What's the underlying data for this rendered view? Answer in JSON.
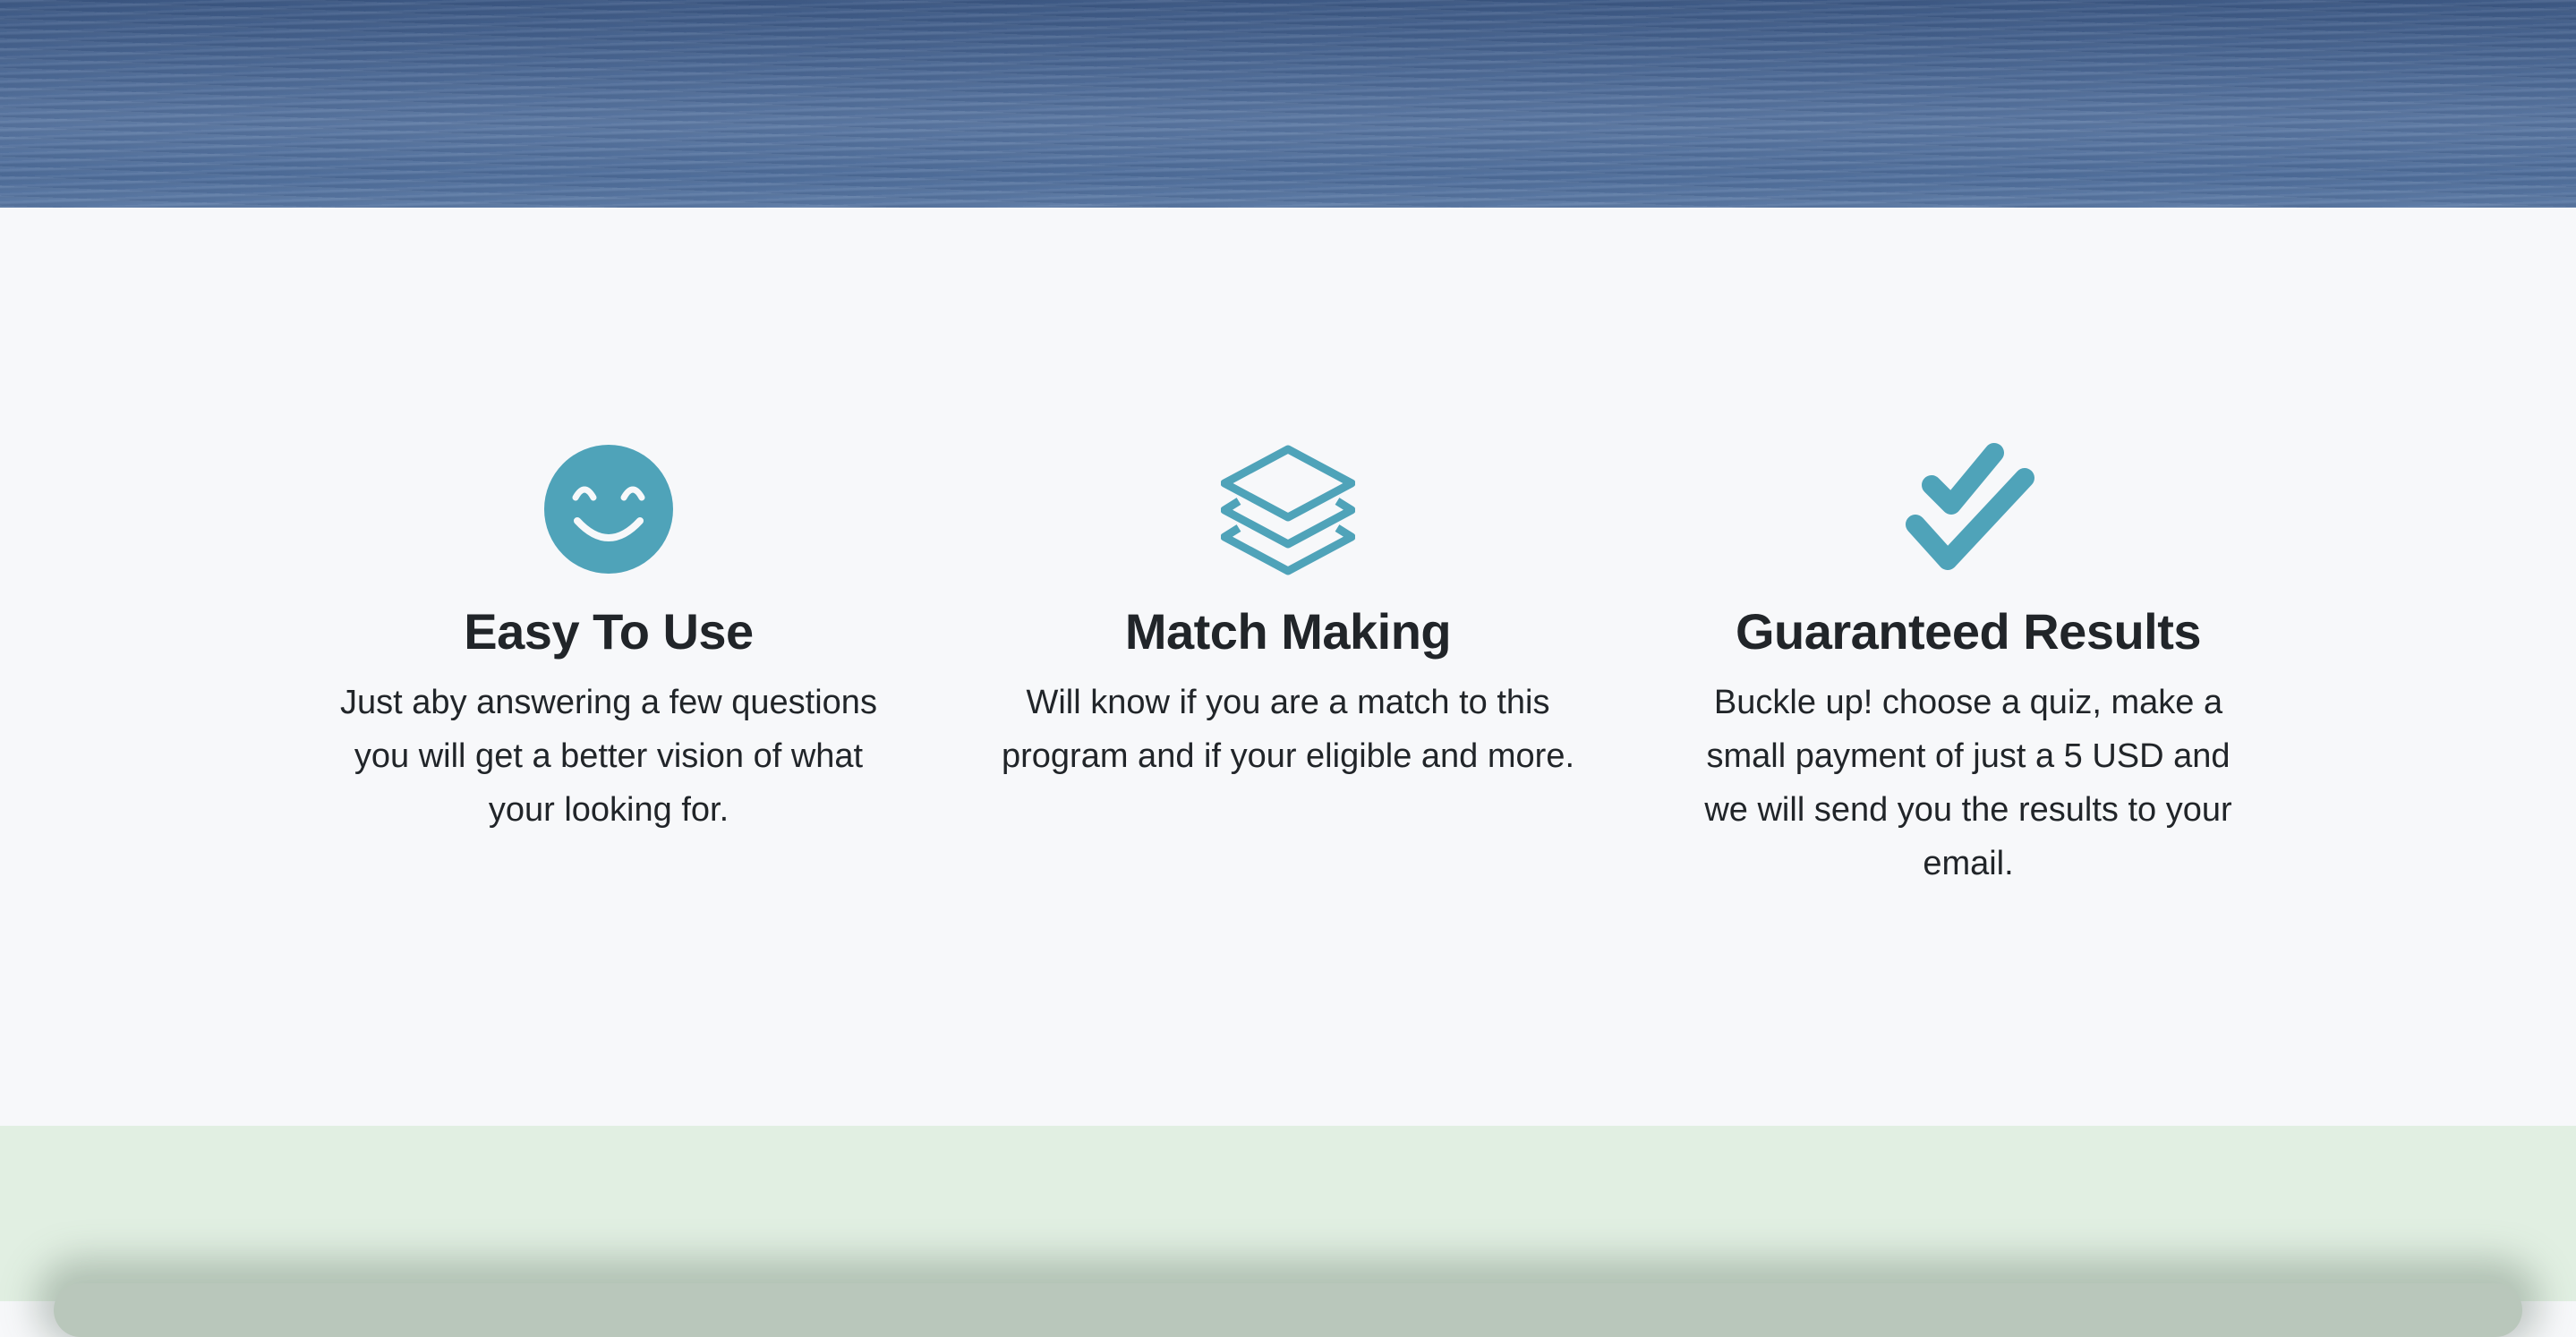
{
  "features": [
    {
      "icon": "smiley-face-icon",
      "title": "Easy To Use",
      "description": "Just aby answering a few questions you will get a better vision of what your looking for."
    },
    {
      "icon": "layers-icon",
      "title": "Match Making",
      "description": "Will know if you are a match to this program and if your eligible and more."
    },
    {
      "icon": "double-check-icon",
      "title": "Guaranteed Results",
      "description": "Buckle up! choose a quiz, make a small payment of just a 5 USD and we will send you the results to your email."
    }
  ],
  "colors": {
    "icon": "#4fa3b9",
    "heading": "#212529",
    "section_bg": "#f7f8fa",
    "cta_bg": "#e1efe2"
  }
}
